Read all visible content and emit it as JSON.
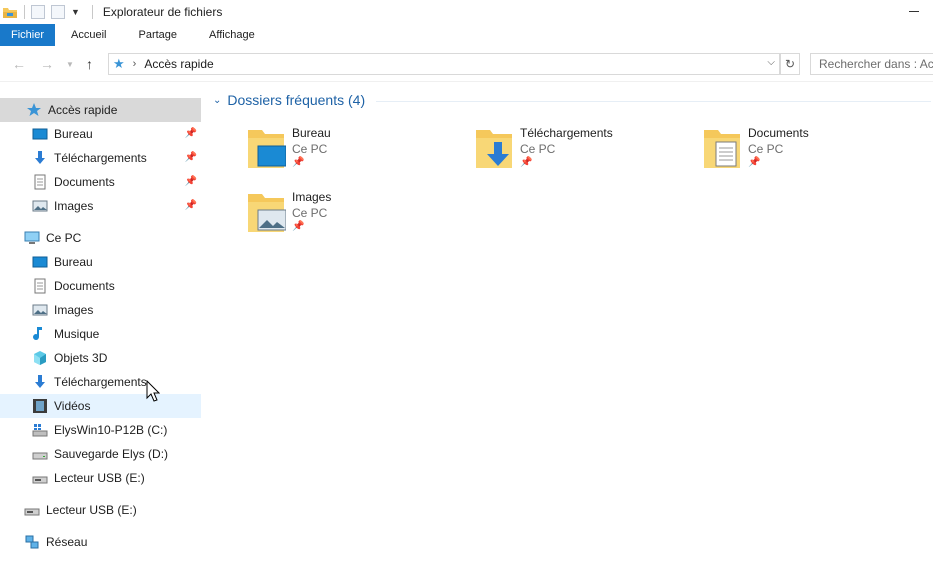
{
  "window": {
    "title": "Explorateur de fichiers"
  },
  "ribbon": {
    "tabs": [
      "Fichier",
      "Accueil",
      "Partage",
      "Affichage"
    ]
  },
  "address": {
    "path": "Accès rapide",
    "search_placeholder": "Rechercher dans : Accès rapide"
  },
  "sidebar": {
    "quick_access": {
      "label": "Accès rapide",
      "icon": "star-icon"
    },
    "quick_items": [
      {
        "label": "Bureau",
        "icon": "desktop-icon",
        "pinned": true
      },
      {
        "label": "Téléchargements",
        "icon": "download-arrow-icon",
        "pinned": true
      },
      {
        "label": "Documents",
        "icon": "document-icon",
        "pinned": true
      },
      {
        "label": "Images",
        "icon": "picture-icon",
        "pinned": true
      }
    ],
    "this_pc": {
      "label": "Ce PC",
      "icon": "computer-icon"
    },
    "pc_items": [
      {
        "label": "Bureau",
        "icon": "desktop-icon"
      },
      {
        "label": "Documents",
        "icon": "document-icon"
      },
      {
        "label": "Images",
        "icon": "picture-icon"
      },
      {
        "label": "Musique",
        "icon": "music-note-icon"
      },
      {
        "label": "Objets 3D",
        "icon": "cube-icon"
      },
      {
        "label": "Téléchargements",
        "icon": "download-arrow-icon"
      },
      {
        "label": "Vidéos",
        "icon": "film-icon"
      },
      {
        "label": "ElysWin10-P12B (C:)",
        "icon": "windows-drive-icon"
      },
      {
        "label": "Sauvegarde Elys (D:)",
        "icon": "drive-icon"
      },
      {
        "label": "Lecteur USB (E:)",
        "icon": "usb-drive-icon"
      }
    ],
    "usb": {
      "label": "Lecteur USB (E:)",
      "icon": "usb-drive-icon"
    },
    "network": {
      "label": "Réseau",
      "icon": "network-icon"
    }
  },
  "main": {
    "group_title": "Dossiers fréquents (4)",
    "folders": [
      {
        "name": "Bureau",
        "location": "Ce PC",
        "icon": "desktop-folder-icon"
      },
      {
        "name": "Téléchargements",
        "location": "Ce PC",
        "icon": "downloads-folder-icon"
      },
      {
        "name": "Documents",
        "location": "Ce PC",
        "icon": "documents-folder-icon"
      },
      {
        "name": "Images",
        "location": "Ce PC",
        "icon": "pictures-folder-icon"
      }
    ]
  },
  "colors": {
    "accent": "#1979ca",
    "group_title": "#1e62a6",
    "selection": "#d9d9d9",
    "hover": "#e5f3ff",
    "folder_yellow": "#f5c85b"
  }
}
